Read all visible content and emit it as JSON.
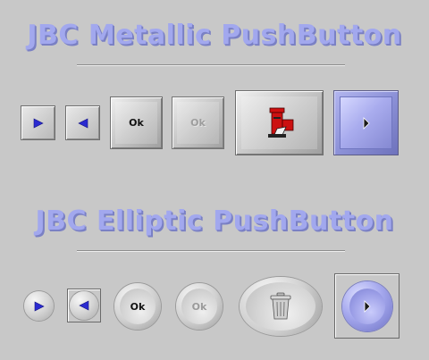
{
  "titles": {
    "metallic": "JBC Metallic PushButton",
    "elliptic": "JBC Elliptic PushButton"
  },
  "metallic_buttons": {
    "ok_label": "Ok",
    "ok_disabled_label": "Ok",
    "icons": [
      "play-right-arrow-icon",
      "play-left-arrow-icon",
      "mailbox-icon",
      "chevron-right-icon"
    ]
  },
  "elliptic_buttons": {
    "ok_label": "Ok",
    "ok_disabled_label": "Ok",
    "icons": [
      "play-right-arrow-icon",
      "play-left-arrow-icon",
      "trash-can-icon",
      "chevron-right-icon"
    ]
  },
  "colors": {
    "background": "#c8c8c8",
    "title": "#a2a8ee",
    "accent_blue": "#2b2bd0",
    "button_blue": "#9a9ee4"
  }
}
